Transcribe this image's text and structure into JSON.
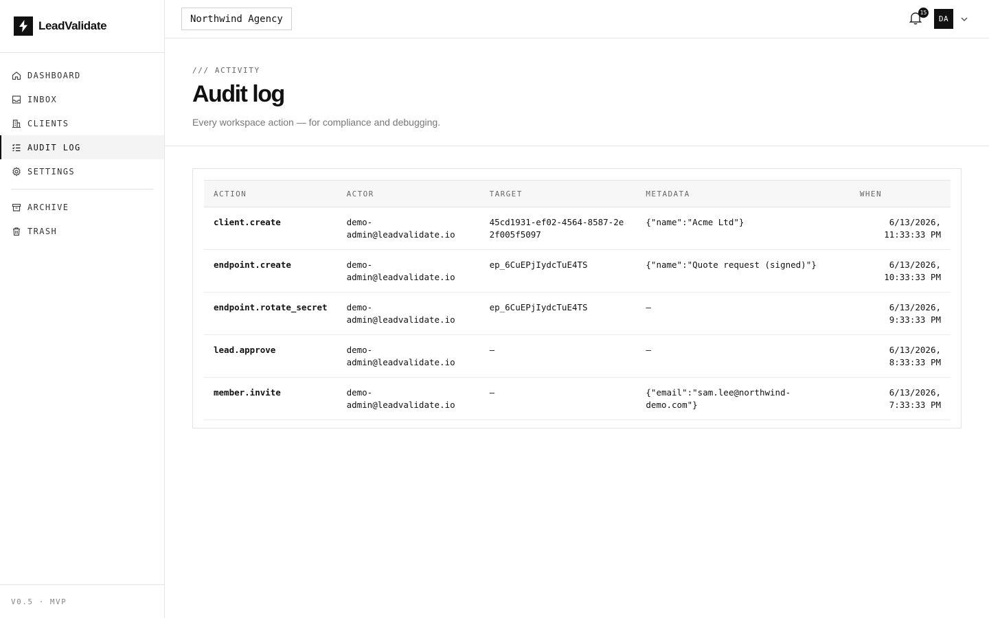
{
  "brand": {
    "name": "LeadValidate"
  },
  "sidebar": {
    "items": [
      {
        "label": "DASHBOARD",
        "icon": "home-icon"
      },
      {
        "label": "INBOX",
        "icon": "inbox-icon"
      },
      {
        "label": "CLIENTS",
        "icon": "building-icon"
      },
      {
        "label": "AUDIT LOG",
        "icon": "list-check-icon",
        "active": true
      },
      {
        "label": "SETTINGS",
        "icon": "gear-icon"
      }
    ],
    "secondary": [
      {
        "label": "ARCHIVE",
        "icon": "archive-icon"
      },
      {
        "label": "TRASH",
        "icon": "trash-icon"
      }
    ],
    "version": "V0.5 · MVP"
  },
  "topbar": {
    "workspace": "Northwind Agency",
    "notifications_count": "15",
    "avatar_initials": "DA"
  },
  "header": {
    "eyebrow": "/// ACTIVITY",
    "title": "Audit log",
    "subtitle": "Every workspace action — for compliance and debugging."
  },
  "table": {
    "columns": [
      "ACTION",
      "ACTOR",
      "TARGET",
      "METADATA",
      "WHEN"
    ],
    "rows": [
      {
        "action": "client.create",
        "actor": "demo-admin@leadvalidate.io",
        "target": "45cd1931-ef02-4564-8587-2e2f005f5097",
        "metadata": "{\"name\":\"Acme Ltd\"}",
        "when": "6/13/2026, 11:33:33 PM"
      },
      {
        "action": "endpoint.create",
        "actor": "demo-admin@leadvalidate.io",
        "target": "ep_6CuEPjIydcTuE4TS",
        "metadata": "{\"name\":\"Quote request (signed)\"}",
        "when": "6/13/2026, 10:33:33 PM"
      },
      {
        "action": "endpoint.rotate_secret",
        "actor": "demo-admin@leadvalidate.io",
        "target": "ep_6CuEPjIydcTuE4TS",
        "metadata": "—",
        "when": "6/13/2026, 9:33:33 PM"
      },
      {
        "action": "lead.approve",
        "actor": "demo-admin@leadvalidate.io",
        "target": "—",
        "metadata": "—",
        "when": "6/13/2026, 8:33:33 PM"
      },
      {
        "action": "member.invite",
        "actor": "demo-admin@leadvalidate.io",
        "target": "—",
        "metadata": "{\"email\":\"sam.lee@northwind-demo.com\"}",
        "when": "6/13/2026, 7:33:33 PM"
      }
    ]
  }
}
